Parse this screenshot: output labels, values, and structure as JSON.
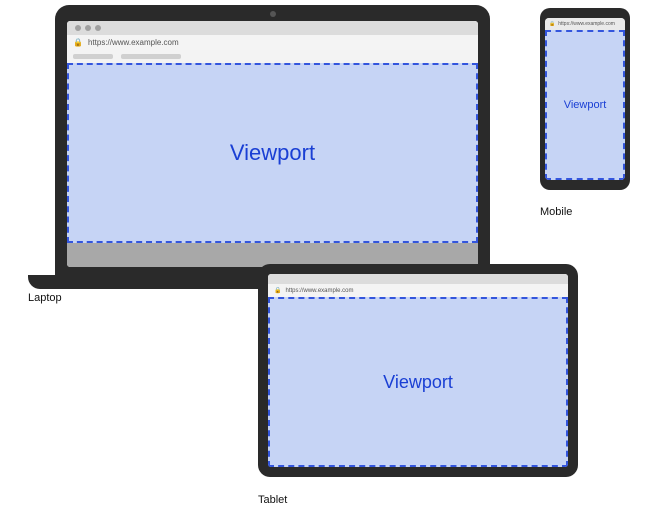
{
  "url": "https://www.example.com",
  "viewport_label": "Viewport",
  "devices": {
    "laptop": {
      "caption": "Laptop"
    },
    "tablet": {
      "caption": "Tablet"
    },
    "mobile": {
      "caption": "Mobile"
    }
  }
}
